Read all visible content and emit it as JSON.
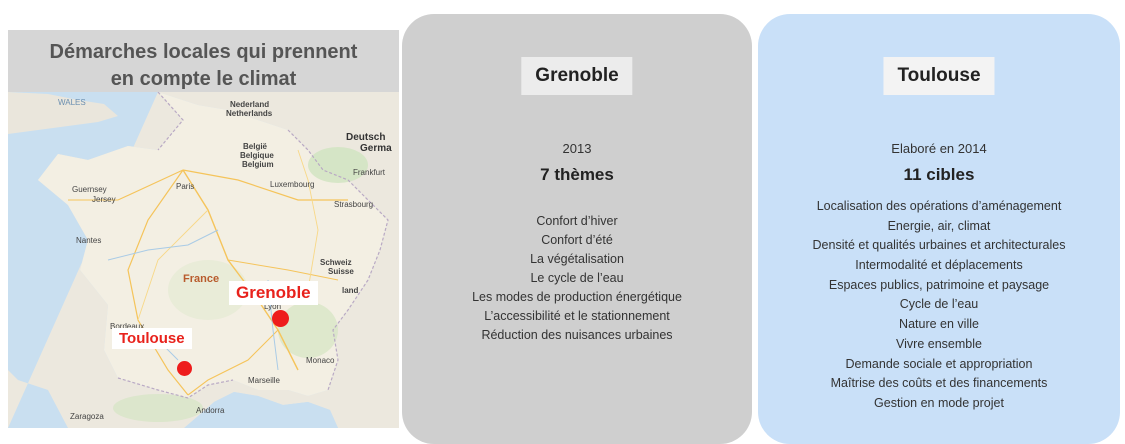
{
  "map": {
    "title_line1": "Démarches locales qui prennent",
    "title_line2": "en compte le climat",
    "labels": {
      "wales": "WALES",
      "nederland": "Nederland",
      "netherlands": "Netherlands",
      "deutsch": "Deutsch",
      "germa": "Germa",
      "belgie": "België",
      "belgique": "Belgique",
      "belgium": "Belgium",
      "luxembourg": "Luxembourg",
      "guernsey": "Guernsey",
      "jersey": "Jersey",
      "france": "France",
      "schweiz": "Schweiz",
      "suisse": "Suisse",
      "land": "land",
      "monaco": "Monaco",
      "andorra": "Andorra",
      "zaragoza": "Zaragoza",
      "paris": "Paris",
      "lyon": "Lyon",
      "marseille": "Marseille",
      "bordeaux": "Bordeaux",
      "nantes": "Nantes",
      "strasbourg": "Strasbourg",
      "frankfurt": "Frankfurt"
    },
    "cities": [
      {
        "name": "Grenoble",
        "color": "#ee1c1c"
      },
      {
        "name": "Toulouse",
        "color": "#ee1c1c"
      }
    ]
  },
  "grenoble": {
    "title": "Grenoble",
    "year": "2013",
    "count": "7 thèmes",
    "items": [
      "Confort d’hiver",
      "Confort d’été",
      "La végétalisation",
      "Le cycle de l’eau",
      "Les modes de production énergétique",
      "L’accessibilité et le stationnement",
      "Réduction des nuisances urbaines"
    ],
    "bg_color": "#cfcfcf"
  },
  "toulouse": {
    "title": "Toulouse",
    "year": "Elaboré en 2014",
    "count": "11 cibles",
    "items": [
      "Localisation des opérations d’aménagement",
      "Energie, air, climat",
      "Densité et qualités urbaines et architecturales",
      "Intermodalité et déplacements",
      "Espaces publics, patrimoine et paysage",
      "Cycle de l’eau",
      "Nature en ville",
      "Vivre ensemble",
      "Demande sociale et appropriation",
      "Maîtrise des coûts et des financements",
      "Gestion en mode projet"
    ],
    "bg_color": "#c9e0f8"
  }
}
